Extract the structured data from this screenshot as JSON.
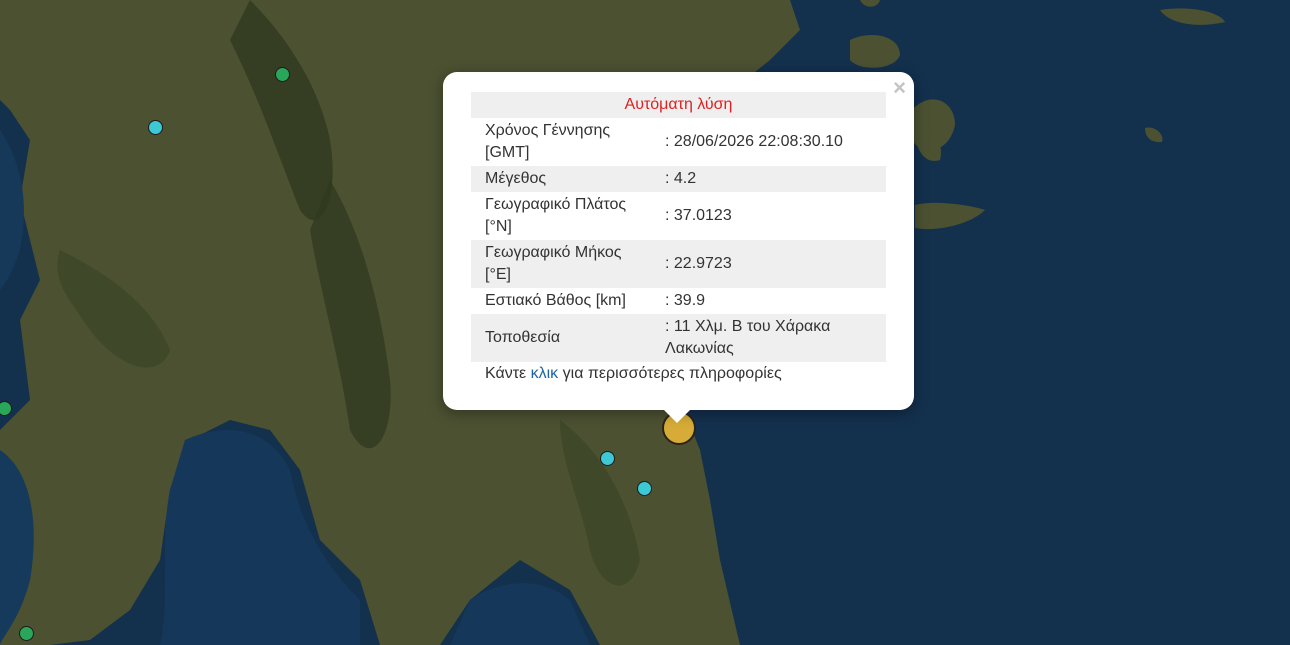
{
  "map": {
    "colors": {
      "sea": "#13304d",
      "land": "#4b5131",
      "mountain": "#2f3a1f"
    },
    "markers": [
      {
        "id": "m1",
        "color": "green"
      },
      {
        "id": "m2",
        "color": "cyan"
      },
      {
        "id": "m3",
        "color": "green"
      },
      {
        "id": "m4",
        "color": "green"
      },
      {
        "id": "m5",
        "color": "cyan"
      },
      {
        "id": "m6",
        "color": "cyan"
      },
      {
        "id": "m7",
        "color": "selected-yellow"
      }
    ]
  },
  "popup": {
    "header": "Αυτόματη λύση",
    "close_icon": "×",
    "rows": [
      {
        "label": "Χρόνος Γέννησης [GMT]",
        "value": ": 28/06/2026 22:08:30.10"
      },
      {
        "label": "Μέγεθος",
        "value": ": 4.2"
      },
      {
        "label": "Γεωγραφικό Πλάτος [°N]",
        "value": ": 37.0123"
      },
      {
        "label": "Γεωγραφικό Μήκος [°E]",
        "value": ": 22.9723"
      },
      {
        "label": "Εστιακό Βάθος [km]",
        "value": ": 39.9"
      },
      {
        "label": "Τοποθεσία",
        "value": ": 11 Χλμ. Β του Χάρακα Λακωνίας"
      }
    ],
    "more": {
      "prefix": "Κάντε ",
      "link": "κλικ",
      "suffix": " για περισσότερες πληροφορίες"
    },
    "colors": {
      "header_text": "#e02020",
      "link": "#1d63a8",
      "row_shade": "#efefef"
    }
  }
}
